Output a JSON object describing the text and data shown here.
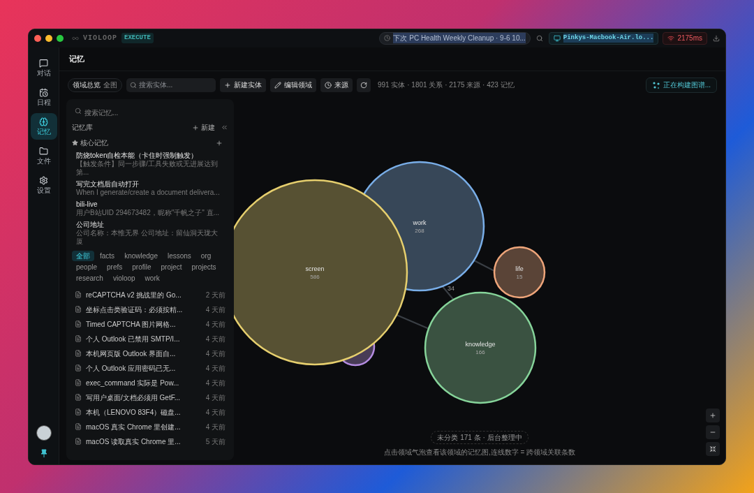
{
  "titlebar": {
    "app_name": "VIOLOOP",
    "mode_badge": "EXECUTE",
    "schedule": "下次 PC Health Weekly Cleanup · 9-6 10...",
    "host": "Pinkys-Macbook-Air.lo...",
    "latency": "2175ms"
  },
  "nav": [
    {
      "label": "对话",
      "selected": false
    },
    {
      "label": "日程",
      "selected": false
    },
    {
      "label": "记忆",
      "selected": true
    },
    {
      "label": "文件",
      "selected": false
    },
    {
      "label": "设置",
      "selected": false
    }
  ],
  "page_title": "记忆",
  "toolbar": {
    "overview": "领域总览",
    "overview_scope": "全图",
    "search_placeholder": "搜索实体...",
    "buttons": [
      "新建实体",
      "编辑领域",
      "来源"
    ],
    "stats": "991 实体 · 1801 关系 · 2175 来源 · 423 记忆",
    "building": "正在构建图谱..."
  },
  "memory_panel": {
    "search_placeholder": "搜索记忆...",
    "title": "记忆库",
    "new_button": "新建",
    "core_title": "核心记忆",
    "core": [
      {
        "title": "防烧token自检本能（卡住时强制触发）",
        "preview": "【触发条件】同一步骤/工具失败或无进展达到第..."
      },
      {
        "title": "写完文档后自动打开",
        "preview": "When I generate/create a document delivera..."
      },
      {
        "title": "bili-live",
        "preview": "用户B站UID 294673482，昵称\"千帆之子\" 直..."
      },
      {
        "title": "公司地址",
        "preview": "公司名称：本惟无界 公司地址：留仙洞天珑大厦"
      }
    ],
    "tags": [
      {
        "label": "全部",
        "selected": true
      },
      {
        "label": "facts",
        "selected": false
      },
      {
        "label": "knowledge",
        "selected": false
      },
      {
        "label": "lessons",
        "selected": false
      },
      {
        "label": "org",
        "selected": false
      },
      {
        "label": "people",
        "selected": false
      },
      {
        "label": "prefs",
        "selected": false
      },
      {
        "label": "profile",
        "selected": false
      },
      {
        "label": "project",
        "selected": false
      },
      {
        "label": "projects",
        "selected": false
      },
      {
        "label": "research",
        "selected": false
      },
      {
        "label": "violoop",
        "selected": false
      },
      {
        "label": "work",
        "selected": false
      }
    ],
    "items": [
      {
        "title": "reCAPTCHA v2 挑战里的 Go...",
        "time": "2 天前"
      },
      {
        "title": "坐标点击类验证码：必须按精...",
        "time": "4 天前"
      },
      {
        "title": "Timed CAPTCHA 图片网格...",
        "time": "4 天前"
      },
      {
        "title": "个人 Outlook 已禁用 SMTP/I...",
        "time": "4 天前"
      },
      {
        "title": "本机网页版 Outlook 界面自...",
        "time": "4 天前"
      },
      {
        "title": "个人 Outlook 应用密码已无...",
        "time": "4 天前"
      },
      {
        "title": "exec_command 实际是 Pow...",
        "time": "4 天前"
      },
      {
        "title": "写用户桌面/文档必须用 GetF...",
        "time": "4 天前"
      },
      {
        "title": "本机（LENOVO 83F4）磁盘...",
        "time": "4 天前"
      },
      {
        "title": "macOS 真实 Chrome 里创建...",
        "time": "4 天前"
      },
      {
        "title": "macOS 读取真实 Chrome 里...",
        "time": "5 天前"
      }
    ]
  },
  "graph": {
    "bubbles": [
      {
        "color": "#b48ce0"
      },
      {
        "label": "screen",
        "count": "586",
        "color": "#e6cf6e"
      },
      {
        "label": "work",
        "count": "268",
        "color": "#79aee8"
      },
      {
        "label": "life",
        "count": "15",
        "color": "#eea57a"
      },
      {
        "label": "knowledge",
        "count": "166",
        "color": "#86d49a"
      }
    ],
    "edge_label": "34",
    "uncategorized": "未分类 171 条 · 后台整理中",
    "hint": "点击领域气泡查看该领域的记忆图,连线数字 = 跨领域关联条数"
  }
}
